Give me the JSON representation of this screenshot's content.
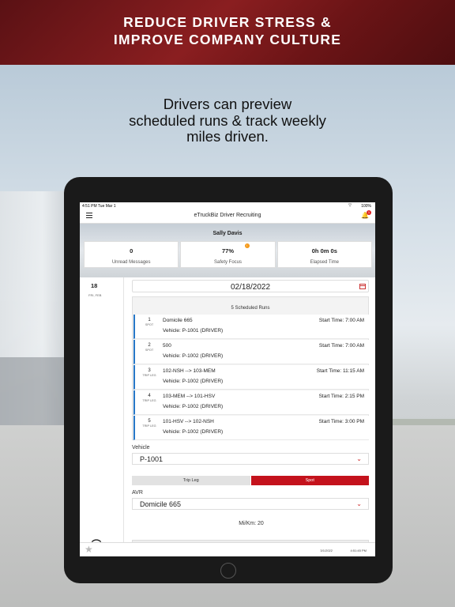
{
  "banner": {
    "line1": "REDUCE DRIVER STRESS &",
    "line2": "IMPROVE COMPANY CULTURE"
  },
  "tagline": {
    "line1": "Drivers can preview",
    "line2": "scheduled runs & track weekly",
    "line3": "miles driven."
  },
  "status_bar": {
    "time": "4:51 PM   Tue Mar 1",
    "battery": "100%",
    "wifi_icon": "wifi-icon"
  },
  "nav": {
    "title": "eTruckBiz Driver Recruiting",
    "menu_icon": "hamburger-icon",
    "bell_icon": "bell-icon",
    "notification_count": "1"
  },
  "profile": {
    "name": "Sally Davis",
    "stats": [
      {
        "value": "0",
        "label": "Unread Messages"
      },
      {
        "value": "77%",
        "label": "Safety Focus",
        "badge": "!"
      },
      {
        "value": "0h 0m 0s",
        "label": "Elapsed Time"
      }
    ]
  },
  "day": {
    "number": "18",
    "label": "FRI, FEB"
  },
  "date_input": {
    "value": "02/18/2022",
    "icon": "calendar-icon"
  },
  "runs": {
    "header": "5 Scheduled Runs",
    "items": [
      {
        "num": "1",
        "kind": "SPOT",
        "loc": "Domicile 665",
        "veh": "Vehicle: P-1001 (DRIVER)",
        "start": "Start Time: 7:00 AM"
      },
      {
        "num": "2",
        "kind": "SPOT",
        "loc": "500",
        "veh": "Vehicle: P-1002 (DRIVER)",
        "start": "Start Time: 7:00 AM"
      },
      {
        "num": "3",
        "kind": "TRIP LEG",
        "loc": "102-NSH --> 103-MEM",
        "veh": "Vehicle: P-1002 (DRIVER)",
        "start": "Start Time: 11:15 AM"
      },
      {
        "num": "4",
        "kind": "TRIP LEG",
        "loc": "103-MEM --> 101-HSV",
        "veh": "Vehicle: P-1002 (DRIVER)",
        "start": "Start Time: 2:15 PM"
      },
      {
        "num": "5",
        "kind": "TRIP LEG",
        "loc": "101-HSV --> 102-NSH",
        "veh": "Vehicle: P-1002 (DRIVER)",
        "start": "Start Time: 3:00 PM"
      }
    ]
  },
  "vehicle": {
    "label": "Vehicle",
    "value": "P-1001"
  },
  "segment": {
    "left": "Trip Leg",
    "right": "Spot",
    "selected": "Spot"
  },
  "avr": {
    "label": "AVR",
    "value": "Domicile 665"
  },
  "mikm": "Mi/Km:  20",
  "footer": {
    "date": "3/1/2022",
    "time": "4:51:45 PM",
    "star_icon": "star-icon"
  },
  "colors": {
    "accent": "#c4121c",
    "run_bar": "#2878c8",
    "badge": "#f59a1b"
  }
}
